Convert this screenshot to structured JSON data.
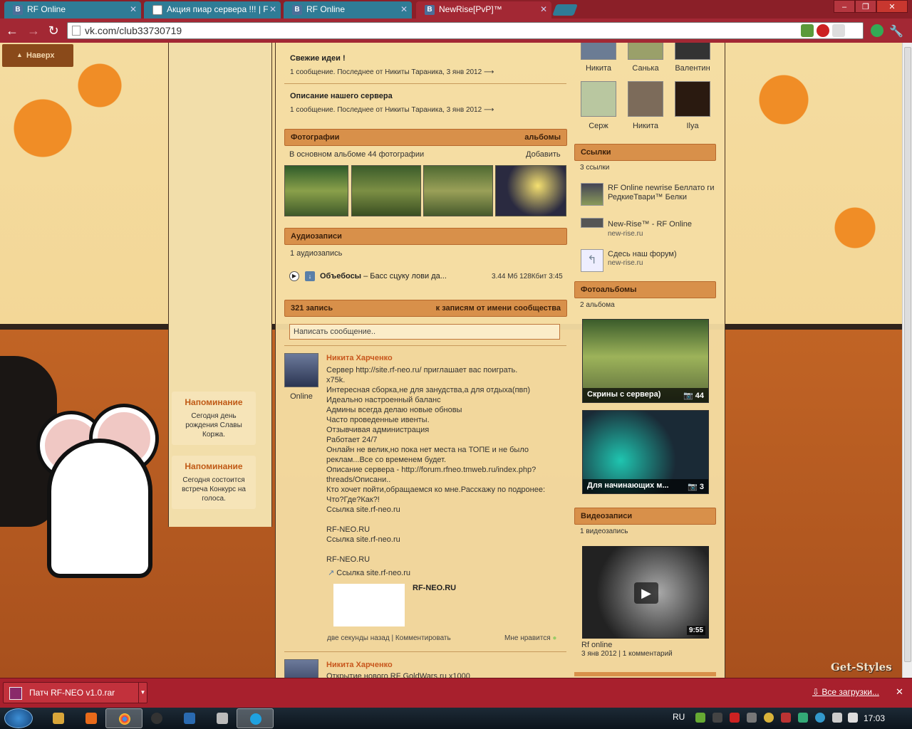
{
  "browser": {
    "tabs": [
      {
        "title": "RF Online",
        "favicon": "B"
      },
      {
        "title": "Акция пиар сервера !!! | F",
        "favicon": ""
      },
      {
        "title": "RF Online",
        "favicon": "B"
      },
      {
        "title": "NewRise[PvP]™",
        "favicon": "B"
      }
    ],
    "url": "vk.com/club33730719",
    "close_glyph": "✕"
  },
  "page": {
    "up_button": "Наверх",
    "reminders": [
      {
        "title": "Напоминание",
        "body": "Сегодня день рождения Славы Коржа."
      },
      {
        "title": "Напоминание",
        "body": "Сегодня состоится встреча Конкурс на голоса."
      }
    ],
    "topics": [
      {
        "title": "Свежие идеи !",
        "meta": "1 сообщение. Последнее от Никиты Тараника, 3 янв 2012"
      },
      {
        "title": "Описание нашего сервера",
        "meta": "1 сообщение. Последнее от Никиты Тараника, 3 янв 2012"
      }
    ],
    "photos": {
      "header": "Фотографии",
      "header_right": "альбомы",
      "summary": "В основном альбоме 44 фотографии",
      "add": "Добавить"
    },
    "audio": {
      "header": "Аудиозаписи",
      "count": "1 аудиозапись",
      "artist": "Объебосы",
      "title": " – Басс сцуку лови да...",
      "meta": "3.44 Мб 128Кбит 3:45"
    },
    "wall": {
      "header": "321 запись",
      "header_right": "к записям от имени сообщества",
      "placeholder": "Написать сообщение..",
      "posts": [
        {
          "author": "Никита Харченко",
          "status": "Online",
          "text": "Сервер http://site.rf-neo.ru/ приглашает вас поиграть.\nx75k.\nИнтересная сборка,не для занудства,а для отдыха(пвп)\nИдеально настроенный баланс\nАдмины всегда делаю новые обновы\nЧасто проведенные ивенты.\nОтзывчивая администрация\nРаботает 24/7\nОнлайн не велик,но пока нет места на ТОПЕ и не было реклам...Все со временем будет.\nОписание сервера - http://forum.rfneo.tmweb.ru/index.php?threads/Описани..\nКто хочет пойти,обращаемся ко мне.Расскажу по подронее: Что?Где?Как?!\nСсылка site.rf-neo.ru\n\nRF-NEO.RU\nСсылка site.rf-neo.ru\n\nRF-NEO.RU",
          "link": "Ссылка site.rf-neo.ru",
          "link_title": "RF-NEO.RU",
          "time": "две секунды назад",
          "comment": "Комментировать",
          "like": "Мне нравится"
        },
        {
          "author": "Никита Харченко",
          "text": "Открытие нового RF GoldWars.ru x1000"
        }
      ]
    },
    "friends": [
      {
        "name": "Никита"
      },
      {
        "name": "Санька"
      },
      {
        "name": "Валентин"
      },
      {
        "name": "Серж"
      },
      {
        "name": "Никита"
      },
      {
        "name": "Ilya"
      }
    ],
    "links": {
      "header": "Ссылки",
      "count": "3 ссылки",
      "items": [
        {
          "title": "RF Online newrise Беллато ги РедкиеТвари™ Белки",
          "sub": ""
        },
        {
          "title": "New-Rise™ - RF Online",
          "sub": "new-rise.ru"
        },
        {
          "title": "Сдесь наш форум)",
          "sub": "new-rise.ru"
        }
      ]
    },
    "albums": {
      "header": "Фотоальбомы",
      "count": "2 альбома",
      "items": [
        {
          "title": "Скрины с сервера)",
          "count": "44"
        },
        {
          "title": "Для начинающих м...",
          "count": "3"
        }
      ]
    },
    "videos": {
      "header": "Видеозаписи",
      "count": "1 видеозапись",
      "duration": "9:55",
      "title": "Rf online",
      "date": "3 янв 2012",
      "comments": "1 комментарий"
    },
    "watermark": "Get-Styles"
  },
  "downloads": {
    "file": "Патч RF-NEO v1.0.rar",
    "all": "Все загрузки..."
  },
  "taskbar": {
    "lang": "RU",
    "time": "17:03"
  }
}
